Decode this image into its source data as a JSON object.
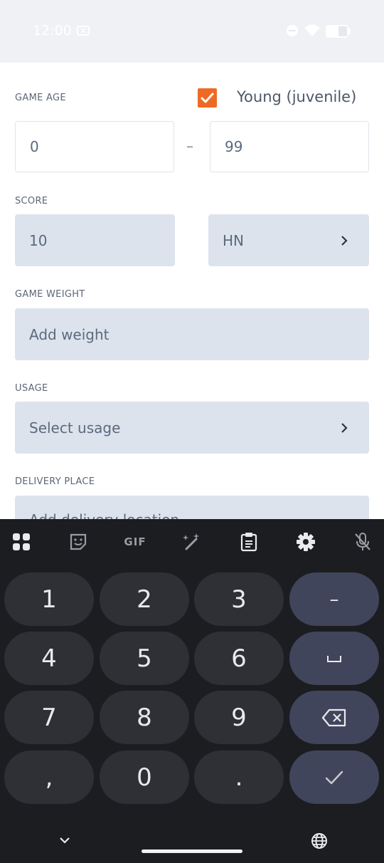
{
  "status_bar": {
    "time": "12:00"
  },
  "form": {
    "game_age": {
      "label": "GAME AGE",
      "min_value": "0",
      "separator": "–",
      "max_value": "99",
      "checkbox_checked": true,
      "checkbox_label": "Young (juvenile)"
    },
    "score": {
      "label": "SCORE",
      "value": "10",
      "unit": "HN"
    },
    "game_weight": {
      "label": "GAME WEIGHT",
      "placeholder": "Add weight"
    },
    "usage": {
      "label": "USAGE",
      "placeholder": "Select usage"
    },
    "delivery_place": {
      "label": "DELIVERY PLACE",
      "placeholder": "Add delivery location"
    }
  },
  "keyboard": {
    "toolbar": {
      "gif_label": "GIF"
    },
    "keys": [
      "1",
      "2",
      "3",
      "–",
      "4",
      "5",
      "6",
      "␣",
      "7",
      "8",
      "9",
      "⌫",
      ",",
      "0",
      ".",
      "✓"
    ]
  },
  "colors": {
    "accent": "#ee6a24",
    "field_bg": "#dde3ec",
    "keyboard_bg": "#1c1d21"
  }
}
